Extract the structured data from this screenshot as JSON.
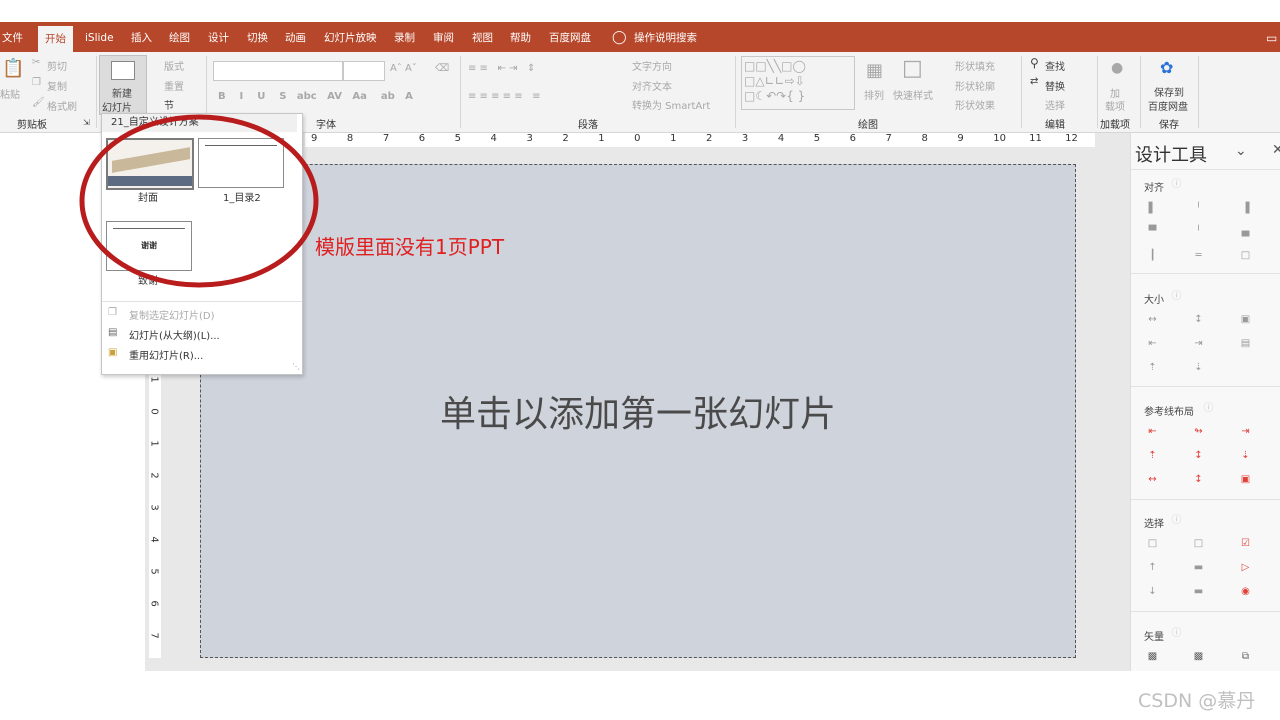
{
  "tabs": [
    "文件",
    "开始",
    "iSlide",
    "插入",
    "绘图",
    "设计",
    "切换",
    "动画",
    "幻灯片放映",
    "录制",
    "审阅",
    "视图",
    "帮助",
    "百度网盘"
  ],
  "active_tab": "开始",
  "tell_me": "操作说明搜索",
  "clipboard": {
    "paste": "粘贴",
    "cut": "剪切",
    "copy": "复制",
    "format_painter": "格式刷",
    "label": "剪贴板"
  },
  "slides_group": {
    "new_slide_line1": "新建",
    "new_slide_line2": "幻灯片",
    "layout": "版式",
    "reset": "重置",
    "section": "节"
  },
  "font_group": {
    "label": "字体"
  },
  "paragraph_group": {
    "text_direction": "文字方向",
    "align_text": "对齐文本",
    "convert_smartart": "转换为 SmartArt",
    "label": "段落"
  },
  "drawing_group": {
    "arrange": "排列",
    "quick_styles": "快速样式",
    "shape_fill": "形状填充",
    "shape_outline": "形状轮廓",
    "shape_effects": "形状效果",
    "label": "绘图"
  },
  "editing_group": {
    "find": "查找",
    "replace": "替换",
    "select": "选择",
    "label": "编辑"
  },
  "addins_group": {
    "addins_line1": "加",
    "addins_line2": "载项",
    "label": "加载项"
  },
  "save_group": {
    "line1": "保存到",
    "line2": "百度网盘",
    "label": "保存"
  },
  "dropdown": {
    "header": "21_自定义设计方案",
    "layouts": [
      "封面",
      "1_目录2",
      "致谢"
    ],
    "thanks_thumb_text": "谢谢",
    "duplicate": "复制选定幻灯片(D)",
    "from_outline": "幻灯片(从大纲)(L)...",
    "reuse": "重用幻灯片(R)..."
  },
  "annotation": {
    "text": "模版里面没有1页PPT",
    "color": "#e02020",
    "circle_color": "#b81c1c"
  },
  "slide": {
    "placeholder": "单击以添加第一张幻灯片"
  },
  "ruler": {
    "h_labels": [
      "9",
      "8",
      "7",
      "6",
      "5",
      "4",
      "3",
      "2",
      "1",
      "0",
      "1",
      "2",
      "3",
      "4",
      "5",
      "6",
      "7",
      "8",
      "9",
      "10",
      "11",
      "12"
    ],
    "v_labels": [
      "1",
      "0",
      "1",
      "2",
      "3",
      "4",
      "5",
      "6",
      "7"
    ]
  },
  "pane": {
    "title": "设计工具",
    "sections": [
      "对齐",
      "大小",
      "参考线布局",
      "选择",
      "矢量"
    ]
  },
  "watermark": "CSDN @慕丹",
  "colors": {
    "accent": "#b7472a",
    "slide_bg": "#ced3dc",
    "pane_icon_red": "#e0423a"
  }
}
